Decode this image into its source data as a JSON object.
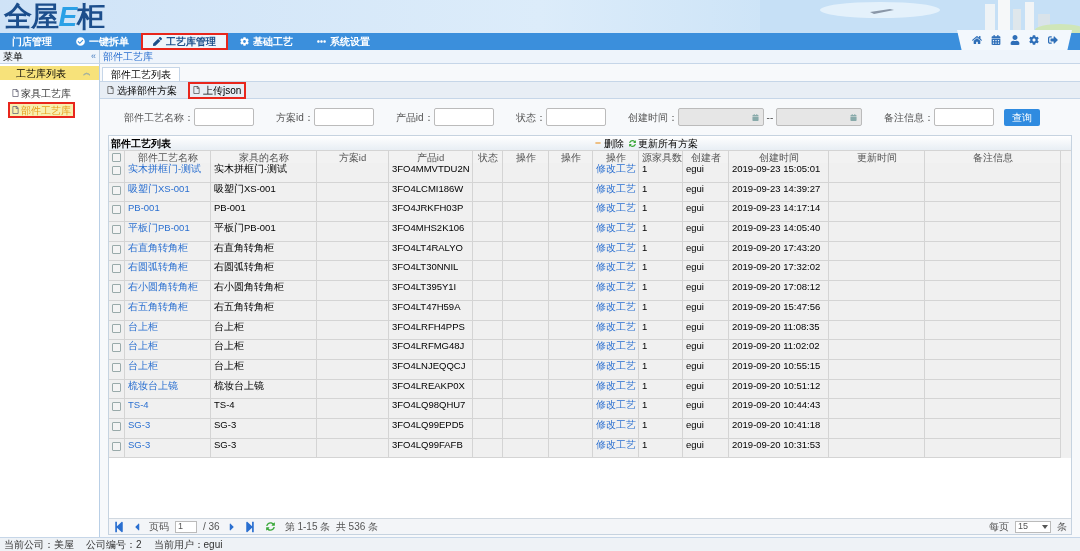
{
  "logo": [
    {
      "text": "全屋",
      "accent": false
    },
    {
      "text": "E",
      "accent": true
    },
    {
      "text": "柜",
      "accent": false
    }
  ],
  "nav": [
    {
      "label": "门店管理",
      "selected": false,
      "highlighted": false
    },
    {
      "label": "一键拆单",
      "selected": false,
      "highlighted": false
    },
    {
      "label": "工艺库管理",
      "selected": true,
      "highlighted": true
    },
    {
      "label": "基础工艺",
      "selected": false,
      "highlighted": false
    },
    {
      "label": "系统设置",
      "selected": false,
      "highlighted": false
    }
  ],
  "sidebar": {
    "title": "菜单",
    "collapse": "«",
    "section": {
      "label": "工艺库列表",
      "toggle": "︽"
    },
    "items": [
      {
        "label": "家具工艺库",
        "selected": false,
        "highlighted": false
      },
      {
        "label": "部件工艺库",
        "selected": true,
        "highlighted": true
      }
    ]
  },
  "breadcrumb": "部件工艺库",
  "tabs": [
    {
      "label": "部件工艺列表",
      "selected": true
    }
  ],
  "actions": [
    {
      "label": "选择部件方案",
      "highlighted": false
    },
    {
      "label": "上传json",
      "highlighted": true
    }
  ],
  "filters": [
    {
      "kind": "text",
      "label": "部件工艺名称："
    },
    {
      "kind": "text",
      "label": "方案id："
    },
    {
      "kind": "text",
      "label": "产品id："
    },
    {
      "kind": "text",
      "label": "状态："
    },
    {
      "kind": "daterange",
      "label": "创建时间：",
      "separator": "--"
    },
    {
      "kind": "text",
      "label": "备注信息："
    }
  ],
  "search_button": "查询",
  "table": {
    "title": "部件工艺列表",
    "header_checked": false,
    "tools": [
      {
        "kind": "delete",
        "label": "删除"
      },
      {
        "kind": "refresh",
        "label": "更新所有方案"
      }
    ],
    "columns": [
      "部件工艺名称",
      "家具的名称",
      "方案id",
      "产品id",
      "状态",
      "操作",
      "操作",
      "操作",
      "源家具数",
      "创建者",
      "创建时间",
      "更新时间",
      "备注信息"
    ],
    "rows": [
      {
        "checked": false,
        "name": "实木拼框门-测试",
        "furniture": "实木拼框门-测试",
        "product_id": "3FO4MMVTDU2N",
        "action": "修改工艺",
        "count": "1",
        "creator": "egui",
        "created": "2019-09-23 15:05:01"
      },
      {
        "checked": false,
        "name": "吸塑门XS-001",
        "furniture": "吸塑门XS-001",
        "product_id": "3FO4LCMI186W",
        "action": "修改工艺",
        "count": "1",
        "creator": "egui",
        "created": "2019-09-23 14:39:27"
      },
      {
        "checked": false,
        "name": "PB-001",
        "furniture": "PB-001",
        "product_id": "3FO4JRKFH03P",
        "action": "修改工艺",
        "count": "1",
        "creator": "egui",
        "created": "2019-09-23 14:17:14"
      },
      {
        "checked": false,
        "name": "平板门PB-001",
        "furniture": "平板门PB-001",
        "product_id": "3FO4MHS2K106",
        "action": "修改工艺",
        "count": "1",
        "creator": "egui",
        "created": "2019-09-23 14:05:40"
      },
      {
        "checked": false,
        "name": "右直角转角柜",
        "furniture": "右直角转角柜",
        "product_id": "3FO4LT4RALYO",
        "action": "修改工艺",
        "count": "1",
        "creator": "egui",
        "created": "2019-09-20 17:43:20"
      },
      {
        "checked": false,
        "name": "右圆弧转角柜",
        "furniture": "右圆弧转角柜",
        "product_id": "3FO4LT30NNIL",
        "action": "修改工艺",
        "count": "1",
        "creator": "egui",
        "created": "2019-09-20 17:32:02"
      },
      {
        "checked": false,
        "name": "右小圆角转角柜",
        "furniture": "右小圆角转角柜",
        "product_id": "3FO4LT395Y1I",
        "action": "修改工艺",
        "count": "1",
        "creator": "egui",
        "created": "2019-09-20 17:08:12"
      },
      {
        "checked": false,
        "name": "右五角转角柜",
        "furniture": "右五角转角柜",
        "product_id": "3FO4LT47H59A",
        "action": "修改工艺",
        "count": "1",
        "creator": "egui",
        "created": "2019-09-20 15:47:56"
      },
      {
        "checked": false,
        "name": "台上柜",
        "furniture": "台上柜",
        "product_id": "3FO4LRFH4PPS",
        "action": "修改工艺",
        "count": "1",
        "creator": "egui",
        "created": "2019-09-20 11:08:35"
      },
      {
        "checked": false,
        "name": "台上柜",
        "furniture": "台上柜",
        "product_id": "3FO4LRFMG48J",
        "action": "修改工艺",
        "count": "1",
        "creator": "egui",
        "created": "2019-09-20 11:02:02"
      },
      {
        "checked": false,
        "name": "台上柜",
        "furniture": "台上柜",
        "product_id": "3FO4LNJEQQCJ",
        "action": "修改工艺",
        "count": "1",
        "creator": "egui",
        "created": "2019-09-20 10:55:15"
      },
      {
        "checked": false,
        "name": "梳妆台上镜",
        "furniture": "梳妆台上镜",
        "product_id": "3FO4LREAKP0X",
        "action": "修改工艺",
        "count": "1",
        "creator": "egui",
        "created": "2019-09-20 10:51:12"
      },
      {
        "checked": false,
        "name": "TS-4",
        "furniture": "TS-4",
        "product_id": "3FO4LQ98QHU7",
        "action": "修改工艺",
        "count": "1",
        "creator": "egui",
        "created": "2019-09-20 10:44:43"
      },
      {
        "checked": false,
        "name": "SG-3",
        "furniture": "SG-3",
        "product_id": "3FO4LQ99EPD5",
        "action": "修改工艺",
        "count": "1",
        "creator": "egui",
        "created": "2019-09-20 10:41:18"
      },
      {
        "checked": false,
        "name": "SG-3",
        "furniture": "SG-3",
        "product_id": "3FO4LQ99FAFB",
        "action": "修改工艺",
        "count": "1",
        "creator": "egui",
        "created": "2019-09-20 10:31:53"
      }
    ]
  },
  "pager": {
    "page_label": "页码",
    "page": "1",
    "total_pages": "/ 36",
    "summary": "第 1-15 条  共 536 条",
    "per_page_label": "每页",
    "per_page": "15",
    "per_page_unit": "条"
  },
  "status_bar": [
    "当前公司：美屋",
    "公司编号：2",
    "当前用户：egui"
  ]
}
